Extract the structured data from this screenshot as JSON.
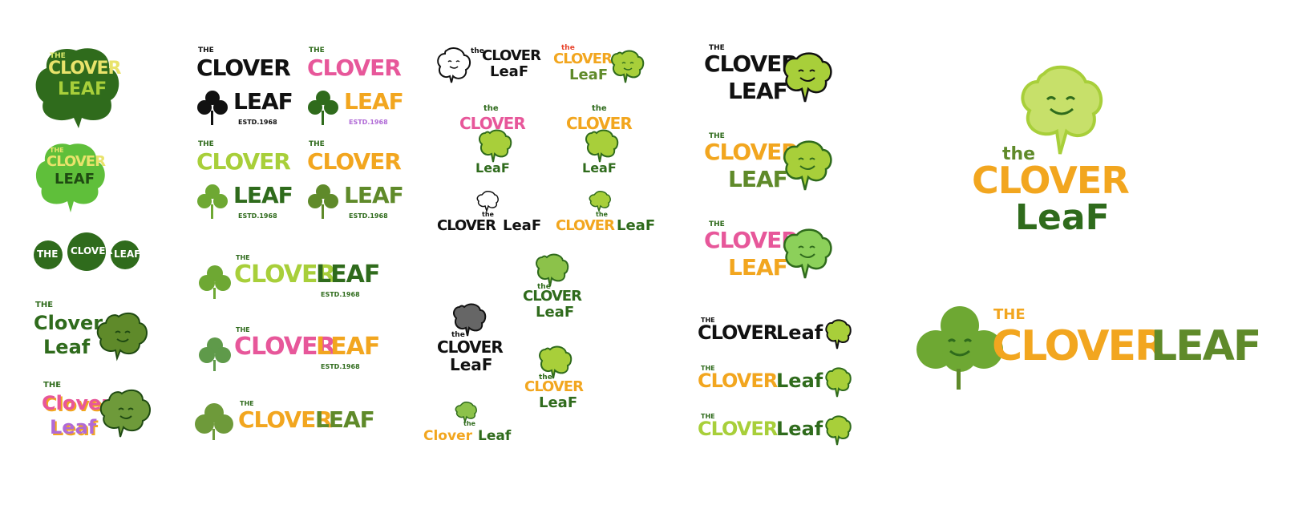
{
  "sheet": {
    "brand_the": "THE",
    "brand_the_lower": "the",
    "brand_clover": "CLOVER",
    "brand_leaf": "LEAF",
    "brand_clover_mixed": "Clover",
    "brand_leaf_mixed": "Leaf",
    "brand_leaf_title": "LeaF",
    "established": "ESTD.1968"
  },
  "palette": {
    "dark_green": "#2f6b1c",
    "mid_green": "#5f9a2a",
    "lime": "#a8cf3a",
    "light_lime": "#c7e06a",
    "orange": "#f2a61f",
    "pink": "#e7579a",
    "purple": "#b06ad6",
    "blue": "#4b5fd6",
    "red": "#e8452e",
    "black": "#111111",
    "gray": "#555555"
  },
  "logos": [
    {
      "name": "col1-badge-dark",
      "colorway": "dark green badge, yellow text"
    },
    {
      "name": "col1-badge-bright",
      "colorway": "bright green badge, yellow text"
    },
    {
      "name": "col1-triple-clover",
      "colorway": "dark green, outlined"
    },
    {
      "name": "col1-script-dark",
      "colorway": "dark green script"
    },
    {
      "name": "col1-script-rainbow",
      "colorway": "rainbow script"
    },
    {
      "name": "col2-stack-black",
      "colorway": "black"
    },
    {
      "name": "col2-stack-rainbow",
      "colorway": "rainbow"
    },
    {
      "name": "col2-stack-lime",
      "colorway": "lime and green"
    },
    {
      "name": "col2-stack-orange",
      "colorway": "orange and green"
    },
    {
      "name": "col2-horizontal-lime",
      "colorway": "lime and green"
    },
    {
      "name": "col2-horizontal-rainbow",
      "colorway": "rainbow"
    },
    {
      "name": "col2-horizontal-orange",
      "colorway": "orange and green"
    },
    {
      "name": "col3-mascot-black",
      "colorway": "black outline"
    },
    {
      "name": "col3-mascot-orange",
      "colorway": "orange and green"
    },
    {
      "name": "col3-stack-rainbow",
      "colorway": "rainbow"
    },
    {
      "name": "col3-stack-orange",
      "colorway": "orange and green"
    },
    {
      "name": "col3-line-black",
      "colorway": "black"
    },
    {
      "name": "col3-line-orange",
      "colorway": "orange and green"
    },
    {
      "name": "col3-stack-dark",
      "colorway": "dark green"
    },
    {
      "name": "col3-stack-gray",
      "colorway": "gray and black"
    },
    {
      "name": "col3-stack-lime-orange",
      "colorway": "orange and green"
    },
    {
      "name": "col3-line-small",
      "colorway": "orange and green"
    },
    {
      "name": "col4-mascot-black",
      "colorway": "black"
    },
    {
      "name": "col4-mascot-orange",
      "colorway": "orange and green"
    },
    {
      "name": "col4-mascot-rainbow",
      "colorway": "rainbow"
    },
    {
      "name": "col4-line-black",
      "colorway": "black"
    },
    {
      "name": "col4-line-orange",
      "colorway": "orange and green"
    },
    {
      "name": "col4-line-lime",
      "colorway": "lime and green"
    },
    {
      "name": "final-mascot-stack",
      "colorway": "orange and green"
    },
    {
      "name": "final-horizontal",
      "colorway": "orange and green"
    }
  ]
}
